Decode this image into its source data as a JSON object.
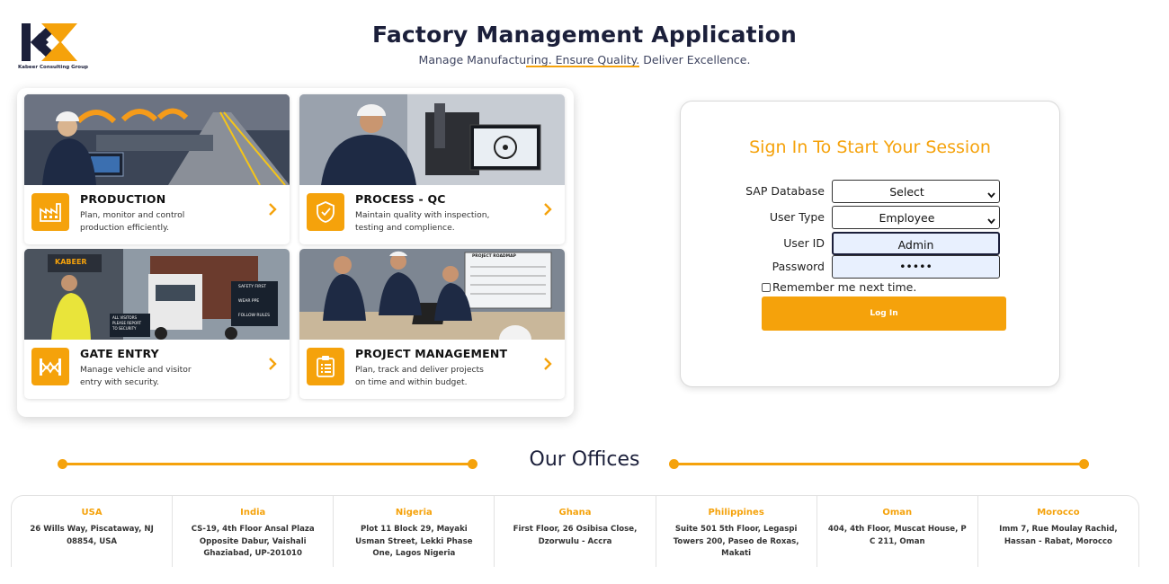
{
  "brand": {
    "caption": "Kabeer Consulting Group",
    "accent": "#f5a20b",
    "navy": "#1b1f3a"
  },
  "header": {
    "title": "Factory Management Application",
    "subtitle": "Manage Manufacturing. Ensure Quality. Deliver Excellence."
  },
  "modules": [
    {
      "title": "PRODUCTION",
      "desc_line1": "Plan, monitor and control",
      "desc_line2": "production efficiently.",
      "icon": "factory-icon"
    },
    {
      "title": "PROCESS - QC",
      "desc_line1": "Maintain quality with inspection,",
      "desc_line2": "testing and complience.",
      "icon": "shield-check-icon"
    },
    {
      "title": "GATE ENTRY",
      "desc_line1": "Manage vehicle and visitor",
      "desc_line2": "entry with security.",
      "icon": "gate-icon",
      "photo_signs": [
        "KABEER",
        "SAFETY FIRST",
        "WEAR PPE",
        "FOLLOW RULES",
        "ALL VISITORS",
        "PLEASE REPORT",
        "TO SECURITY"
      ]
    },
    {
      "title": "PROJECT MANAGEMENT",
      "desc_line1": "Plan, track and deliver projects",
      "desc_line2": "on time and within budget.",
      "icon": "clipboard-icon",
      "photo_signs": [
        "PROJECT ROADMAP"
      ]
    }
  ],
  "login": {
    "heading": "Sign In To Start Your Session",
    "sap_label": "SAP Database",
    "sap_value": "Select",
    "usertype_label": "User Type",
    "usertype_value": "Employee",
    "userid_label": "User ID",
    "userid_value": "Admin",
    "password_label": "Password",
    "password_value": "•••••",
    "remember_label": "Remember me next time.",
    "button_label": "Log In"
  },
  "offices": {
    "title": "Our Offices",
    "items": [
      {
        "country": "USA",
        "address": "26 Wills Way, Piscataway, NJ 08854, USA"
      },
      {
        "country": "India",
        "address": "CS-19, 4th Floor Ansal Plaza Opposite Dabur, Vaishali Ghaziabad, UP-201010"
      },
      {
        "country": "Nigeria",
        "address": "Plot 11 Block 29, Mayaki Usman Street, Lekki Phase One, Lagos Nigeria"
      },
      {
        "country": "Ghana",
        "address": "First Floor, 26 Osibisa Close, Dzorwulu - Accra"
      },
      {
        "country": "Philippines",
        "address": "Suite 501 5th Floor, Legaspi Towers 200, Paseo de Roxas, Makati"
      },
      {
        "country": "Oman",
        "address": "404, 4th Floor, Muscat House, P C 211, Oman"
      },
      {
        "country": "Morocco",
        "address": "Imm 7, Rue Moulay Rachid, Hassan - Rabat, Morocco"
      }
    ]
  }
}
